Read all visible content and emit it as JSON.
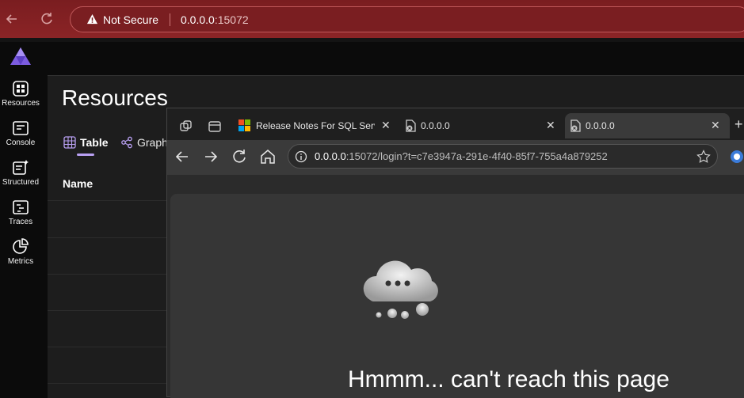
{
  "outer_browser": {
    "security_label": "Not Secure",
    "url_host": "0.0.0.0",
    "url_port": ":15072"
  },
  "nav": {
    "items": [
      {
        "label": "Resources",
        "icon": "resources-icon"
      },
      {
        "label": "Console",
        "icon": "console-icon"
      },
      {
        "label": "Structured",
        "icon": "structured-icon"
      },
      {
        "label": "Traces",
        "icon": "traces-icon"
      },
      {
        "label": "Metrics",
        "icon": "metrics-icon"
      }
    ]
  },
  "resources": {
    "title": "Resources",
    "tabs": [
      {
        "label": "Table",
        "icon": "table-icon",
        "selected": true
      },
      {
        "label": "Graph",
        "icon": "graph-icon",
        "selected": false
      }
    ],
    "column_header": "Name"
  },
  "edge": {
    "tabs": [
      {
        "label": "Release Notes For SQL Serv",
        "icon": "microsoft-logo-icon"
      },
      {
        "label": "0.0.0.0",
        "icon": "page-error-icon"
      },
      {
        "label": "0.0.0.0",
        "icon": "page-error-icon",
        "active": true
      }
    ],
    "address": {
      "host": "0.0.0.0",
      "rest": ":15072/login?t=c7e3947a-291e-4f40-85f7-755a4a879252"
    },
    "error_title": "Hmmm... can't reach this page"
  },
  "colors": {
    "outer_bar": "#8b2426",
    "accent": "#b9a0f2",
    "page_bg": "#1d1d1d"
  }
}
